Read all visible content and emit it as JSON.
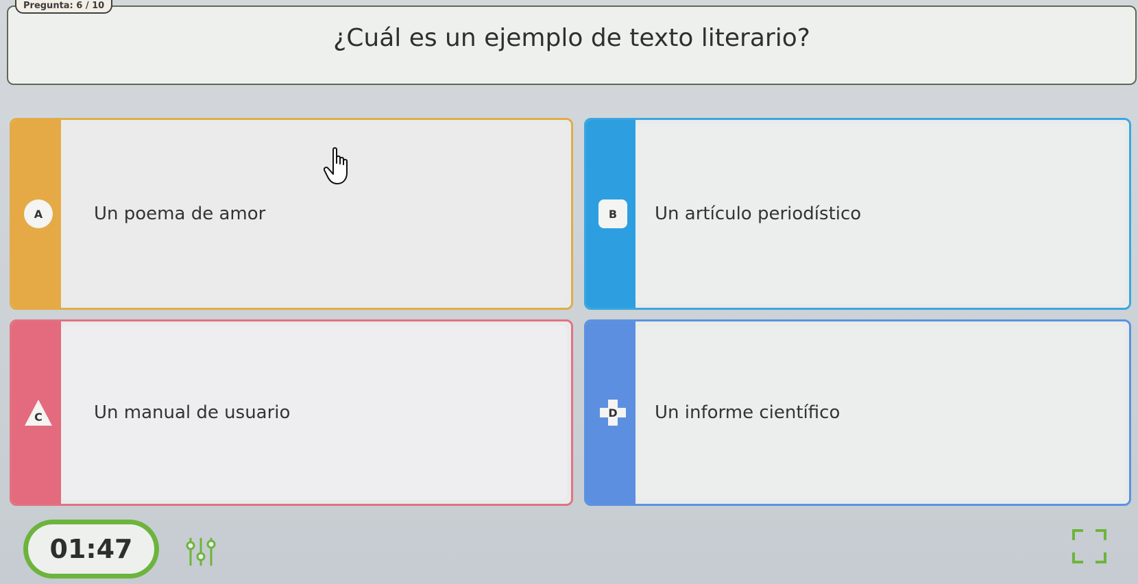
{
  "header": {
    "counter_text": "Pregunta: 6 / 10",
    "question": "¿Cuál es un ejemplo de texto literario?"
  },
  "answers": [
    {
      "letter": "A",
      "text": "Un poema de amor",
      "color": "#e5aa45",
      "shape": "circle"
    },
    {
      "letter": "B",
      "text": "Un artículo periodístico",
      "color": "#2d9fe0",
      "shape": "rounded-square"
    },
    {
      "letter": "C",
      "text": "Un manual de usuario",
      "color": "#e36b7d",
      "shape": "triangle"
    },
    {
      "letter": "D",
      "text": "Un informe científico",
      "color": "#5c8fe0",
      "shape": "cross"
    }
  ],
  "footer": {
    "timer": "01:47",
    "timer_color": "#6db43c",
    "settings_icon": "sliders-icon",
    "fullscreen_icon": "fullscreen-icon"
  }
}
